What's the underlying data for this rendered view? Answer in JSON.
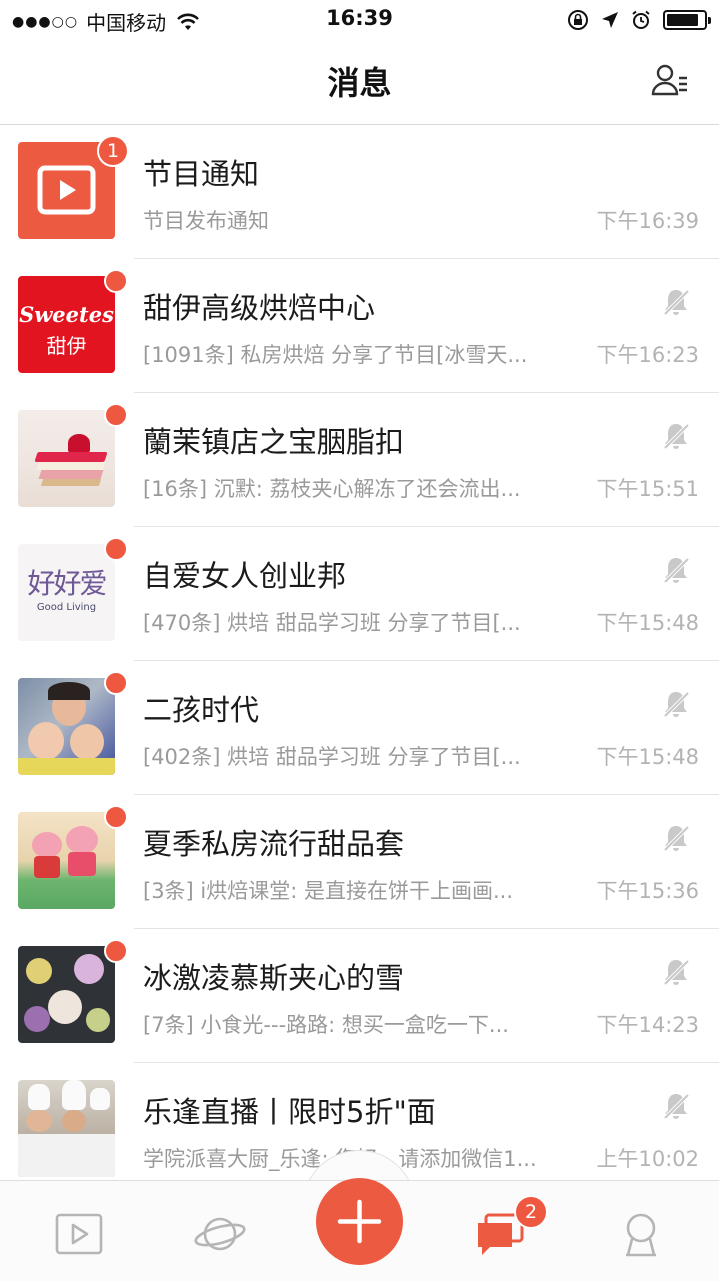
{
  "status_bar": {
    "signal_dots": "●●●○○",
    "carrier": "中国移动",
    "time": "16:39",
    "battery_level": 0.85
  },
  "nav": {
    "title": "消息",
    "contacts_icon": "contacts-list-icon"
  },
  "conversations": [
    {
      "title": "节目通知",
      "preview": "节目发布通知",
      "time": "下午16:39",
      "badge_count": "1",
      "muted": false,
      "avatar": "play-video-icon"
    },
    {
      "title": "甜伊高级烘焙中心",
      "preview": "[1091条] 私房烘焙 分享了节目[冰雪天...",
      "time": "下午16:23",
      "muted": true,
      "avatar": "sweetes-logo",
      "avatar_text": "Sweetes",
      "avatar_sub": "甜伊"
    },
    {
      "title": "蘭茉镇店之宝胭脂扣",
      "preview": "[16条] 沉默: 荔枝夹心解冻了还会流出...",
      "time": "下午15:51",
      "muted": true,
      "avatar": "cake-photo"
    },
    {
      "title": "自爱女人创业邦",
      "preview": "[470条] 烘培 甜品学习班 分享了节目[...",
      "time": "下午15:48",
      "muted": true,
      "avatar": "good-living-logo",
      "avatar_text": "好好爱",
      "avatar_sub": "Good Living"
    },
    {
      "title": "二孩时代",
      "preview": "[402条] 烘培 甜品学习班 分享了节目[...",
      "time": "下午15:48",
      "muted": true,
      "avatar": "family-photo"
    },
    {
      "title": "夏季私房流行甜品套",
      "preview": "[3条] i烘焙课堂: 是直接在饼干上画画...",
      "time": "下午15:36",
      "muted": true,
      "avatar": "pig-cake-photo"
    },
    {
      "title": "冰激凌慕斯夹心的雪",
      "preview": "[7条] 小食光---路路: 想买一盒吃一下...",
      "time": "下午14:23",
      "muted": true,
      "avatar": "dessert-photo"
    },
    {
      "title": "乐逢直播丨限时5折\"面",
      "preview": "学院派喜大厨_乐逢: 您好，请添加微信1...",
      "time": "上午10:02",
      "muted": true,
      "avatar": "chefs-photo"
    }
  ],
  "tab_bar": {
    "tabs": [
      "video-tab-icon",
      "planet-tab-icon",
      "add-button-icon",
      "messages-tab-icon",
      "profile-tab-icon"
    ],
    "messages_badge": "2",
    "accent": "#ec5a41"
  }
}
